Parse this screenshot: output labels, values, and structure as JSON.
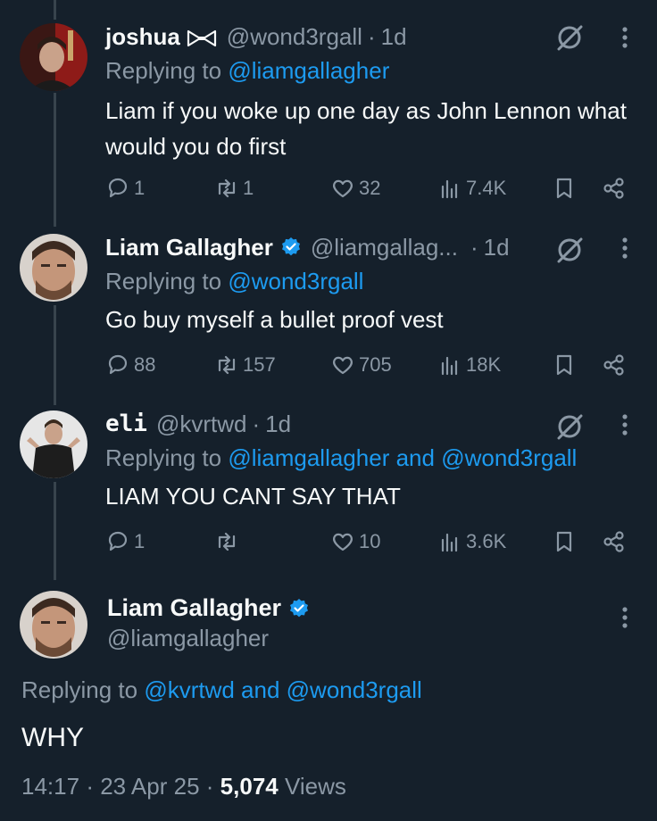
{
  "tweets": [
    {
      "name": "joshua",
      "handle": "@wond3rgall",
      "time": "1d",
      "reply_prefix": "Replying to ",
      "reply_to": "@liamgallagher",
      "reply_and": "",
      "reply_to2": "",
      "text": "Liam if you woke up one day as John Lennon what would you do first",
      "replies": "1",
      "reposts": "1",
      "likes": "32",
      "views": "7.4K"
    },
    {
      "name": "Liam Gallagher",
      "handle": "@liamgallag...",
      "time": "1d",
      "reply_prefix": "Replying to ",
      "reply_to": "@wond3rgall",
      "text": "Go buy myself a bullet proof vest",
      "replies": "88",
      "reposts": "157",
      "likes": "705",
      "views": "18K"
    },
    {
      "name": "eli",
      "handle": "@kvrtwd",
      "time": "1d",
      "reply_prefix": "Replying to ",
      "reply_to": "@liamgallagher",
      "reply_and": " and ",
      "reply_to2": "@wond3rgall",
      "text": "LIAM YOU CANT SAY THAT",
      "replies": "1",
      "reposts": "",
      "likes": "10",
      "views": "3.6K"
    }
  ],
  "main_tweet": {
    "name": "Liam Gallagher",
    "handle": "@liamgallagher",
    "reply_prefix": "Replying to ",
    "reply_to": "@kvrtwd",
    "reply_and": " and ",
    "reply_to2": "@wond3rgall",
    "text": "WHY",
    "time": "14:17",
    "date": "23 Apr 25",
    "views_count": "5,074",
    "views_label": "Views"
  },
  "separator": "·",
  "colors": {
    "background": "#15202b",
    "text": "#f7f9f9",
    "muted": "#8b98a5",
    "link": "#1d9bf0",
    "thread_line": "#38444d"
  },
  "icons": [
    "grok-icon",
    "more-icon",
    "reply-icon",
    "repost-icon",
    "like-icon",
    "views-icon",
    "bookmark-icon",
    "share-icon",
    "verified-icon",
    "bowtie-icon"
  ]
}
